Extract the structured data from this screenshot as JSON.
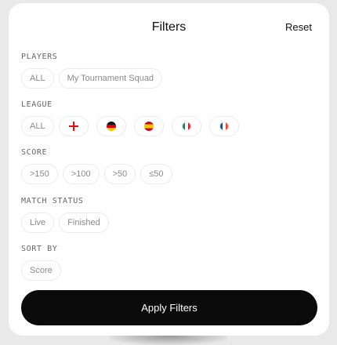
{
  "header": {
    "title": "Filters",
    "reset_label": "Reset"
  },
  "players": {
    "label": "PLAYERS",
    "options": [
      "ALL",
      "My Tournament Squad"
    ]
  },
  "league": {
    "label": "LEAGUE",
    "all_label": "ALL",
    "flags": [
      "england-flag-icon",
      "germany-flag-icon",
      "spain-flag-icon",
      "italy-flag-icon",
      "france-flag-icon"
    ]
  },
  "score": {
    "label": "SCORE",
    "options": [
      ">150",
      ">100",
      ">50",
      "≤50"
    ]
  },
  "match_status": {
    "label": "MATCH STATUS",
    "options": [
      "Live",
      "Finished"
    ]
  },
  "sort_by": {
    "label": "SORT BY",
    "options": [
      "Score"
    ]
  },
  "apply_label": "Apply Filters"
}
